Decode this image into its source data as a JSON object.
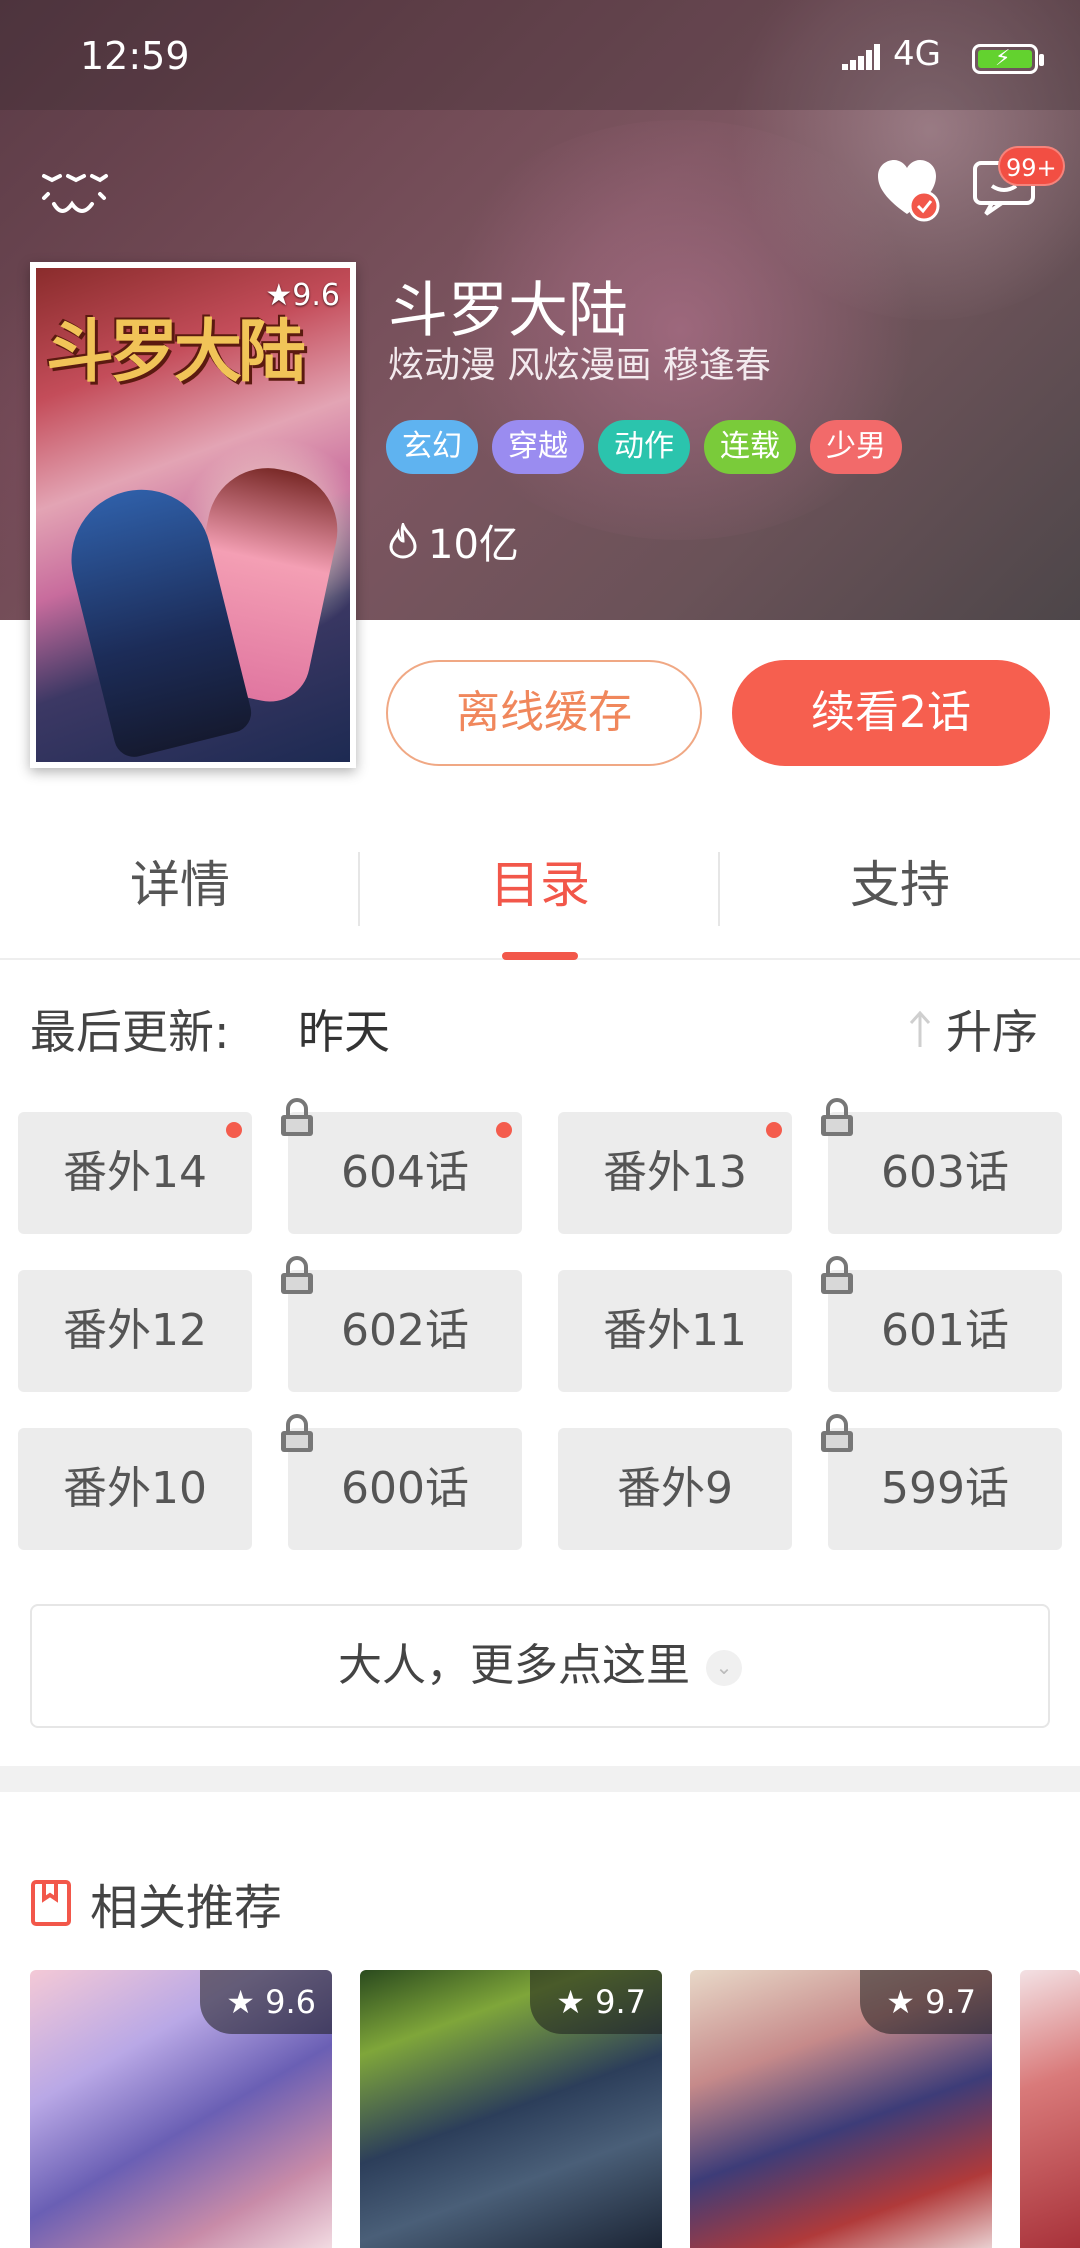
{
  "status_bar": {
    "time": "12:59",
    "network": "4G"
  },
  "header": {
    "message_badge": "99+"
  },
  "book": {
    "title": "斗罗大陆",
    "authors": "炫动漫 风炫漫画 穆逢春",
    "rating": "9.6",
    "cover_text": "斗罗大陆",
    "tags": [
      {
        "label": "玄幻",
        "color": "#5fb3f0"
      },
      {
        "label": "穿越",
        "color": "#9a8cf0"
      },
      {
        "label": "动作",
        "color": "#2bc4ad"
      },
      {
        "label": "连载",
        "color": "#7acb3a"
      },
      {
        "label": "少男",
        "color": "#f26a6a"
      }
    ],
    "popularity": "10亿"
  },
  "actions": {
    "offline_cache": "离线缓存",
    "continue": "续看2话"
  },
  "tabs": [
    {
      "label": "详情"
    },
    {
      "label": "目录"
    },
    {
      "label": "支持"
    }
  ],
  "catalog": {
    "last_update_label": "最后更新:",
    "last_update_value": "昨天",
    "sort_label": "升序",
    "episodes": [
      {
        "label": "番外14",
        "new": true,
        "locked": false
      },
      {
        "label": "604话",
        "new": true,
        "locked": true
      },
      {
        "label": "番外13",
        "new": true,
        "locked": false
      },
      {
        "label": "603话",
        "new": false,
        "locked": true
      },
      {
        "label": "番外12",
        "new": false,
        "locked": false
      },
      {
        "label": "602话",
        "new": false,
        "locked": true
      },
      {
        "label": "番外11",
        "new": false,
        "locked": false
      },
      {
        "label": "601话",
        "new": false,
        "locked": true
      },
      {
        "label": "番外10",
        "new": false,
        "locked": false
      },
      {
        "label": "600话",
        "new": false,
        "locked": true
      },
      {
        "label": "番外9",
        "new": false,
        "locked": false
      },
      {
        "label": "599话",
        "new": false,
        "locked": true
      }
    ],
    "more_label": "大人，更多点这里"
  },
  "recommend": {
    "title": "相关推荐",
    "items": [
      {
        "rating": "9.6"
      },
      {
        "rating": "9.7"
      },
      {
        "rating": "9.7"
      }
    ]
  }
}
